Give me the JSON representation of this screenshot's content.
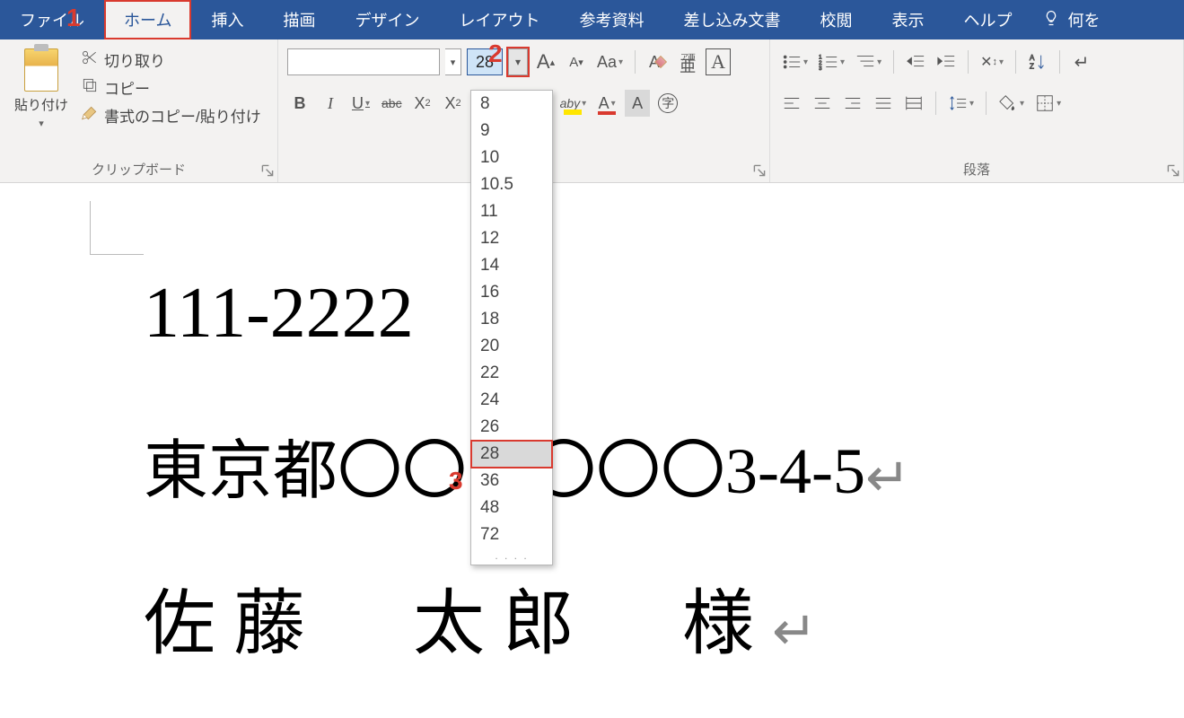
{
  "tabs": {
    "file": "ファイル",
    "home": "ホーム",
    "insert": "挿入",
    "draw": "描画",
    "design": "デザイン",
    "layout": "レイアウト",
    "references": "参考資料",
    "mailings": "差し込み文書",
    "review": "校閲",
    "view": "表示",
    "help": "ヘルプ",
    "tellme": "何を"
  },
  "clipboard": {
    "paste_label": "貼り付け",
    "cut_label": "切り取り",
    "copy_label": "コピー",
    "format_painter_label": "書式のコピー/貼り付け",
    "group_label": "クリップボード"
  },
  "font": {
    "name_value": "",
    "size_value": "28",
    "increase_label": "A",
    "decrease_label": "A",
    "case_label": "Aa",
    "bold_label": "B",
    "italic_label": "I",
    "underline_label": "U",
    "strike_label": "abc",
    "sub_label": "X",
    "sup_label": "X",
    "highlight_label": "aby",
    "fontcolor_label": "A",
    "char_shade_label": "A",
    "enclose_label": "字",
    "char_border_label": "A",
    "ruby_top": "ア亜",
    "ruby_bottom": "亜",
    "clear_format_label": "A"
  },
  "paragraph": {
    "group_label": "段落"
  },
  "size_dropdown": {
    "items": [
      "8",
      "9",
      "10",
      "10.5",
      "11",
      "12",
      "14",
      "16",
      "18",
      "20",
      "22",
      "24",
      "26",
      "28",
      "36",
      "48",
      "72"
    ],
    "hovered": "28"
  },
  "document": {
    "line1": "111-2222",
    "line2": "東京都〇〇区〇〇〇3-4-5",
    "line3": "佐藤　太郎　様"
  },
  "annotations": {
    "a1": "1",
    "a2": "2",
    "a3": "3"
  }
}
